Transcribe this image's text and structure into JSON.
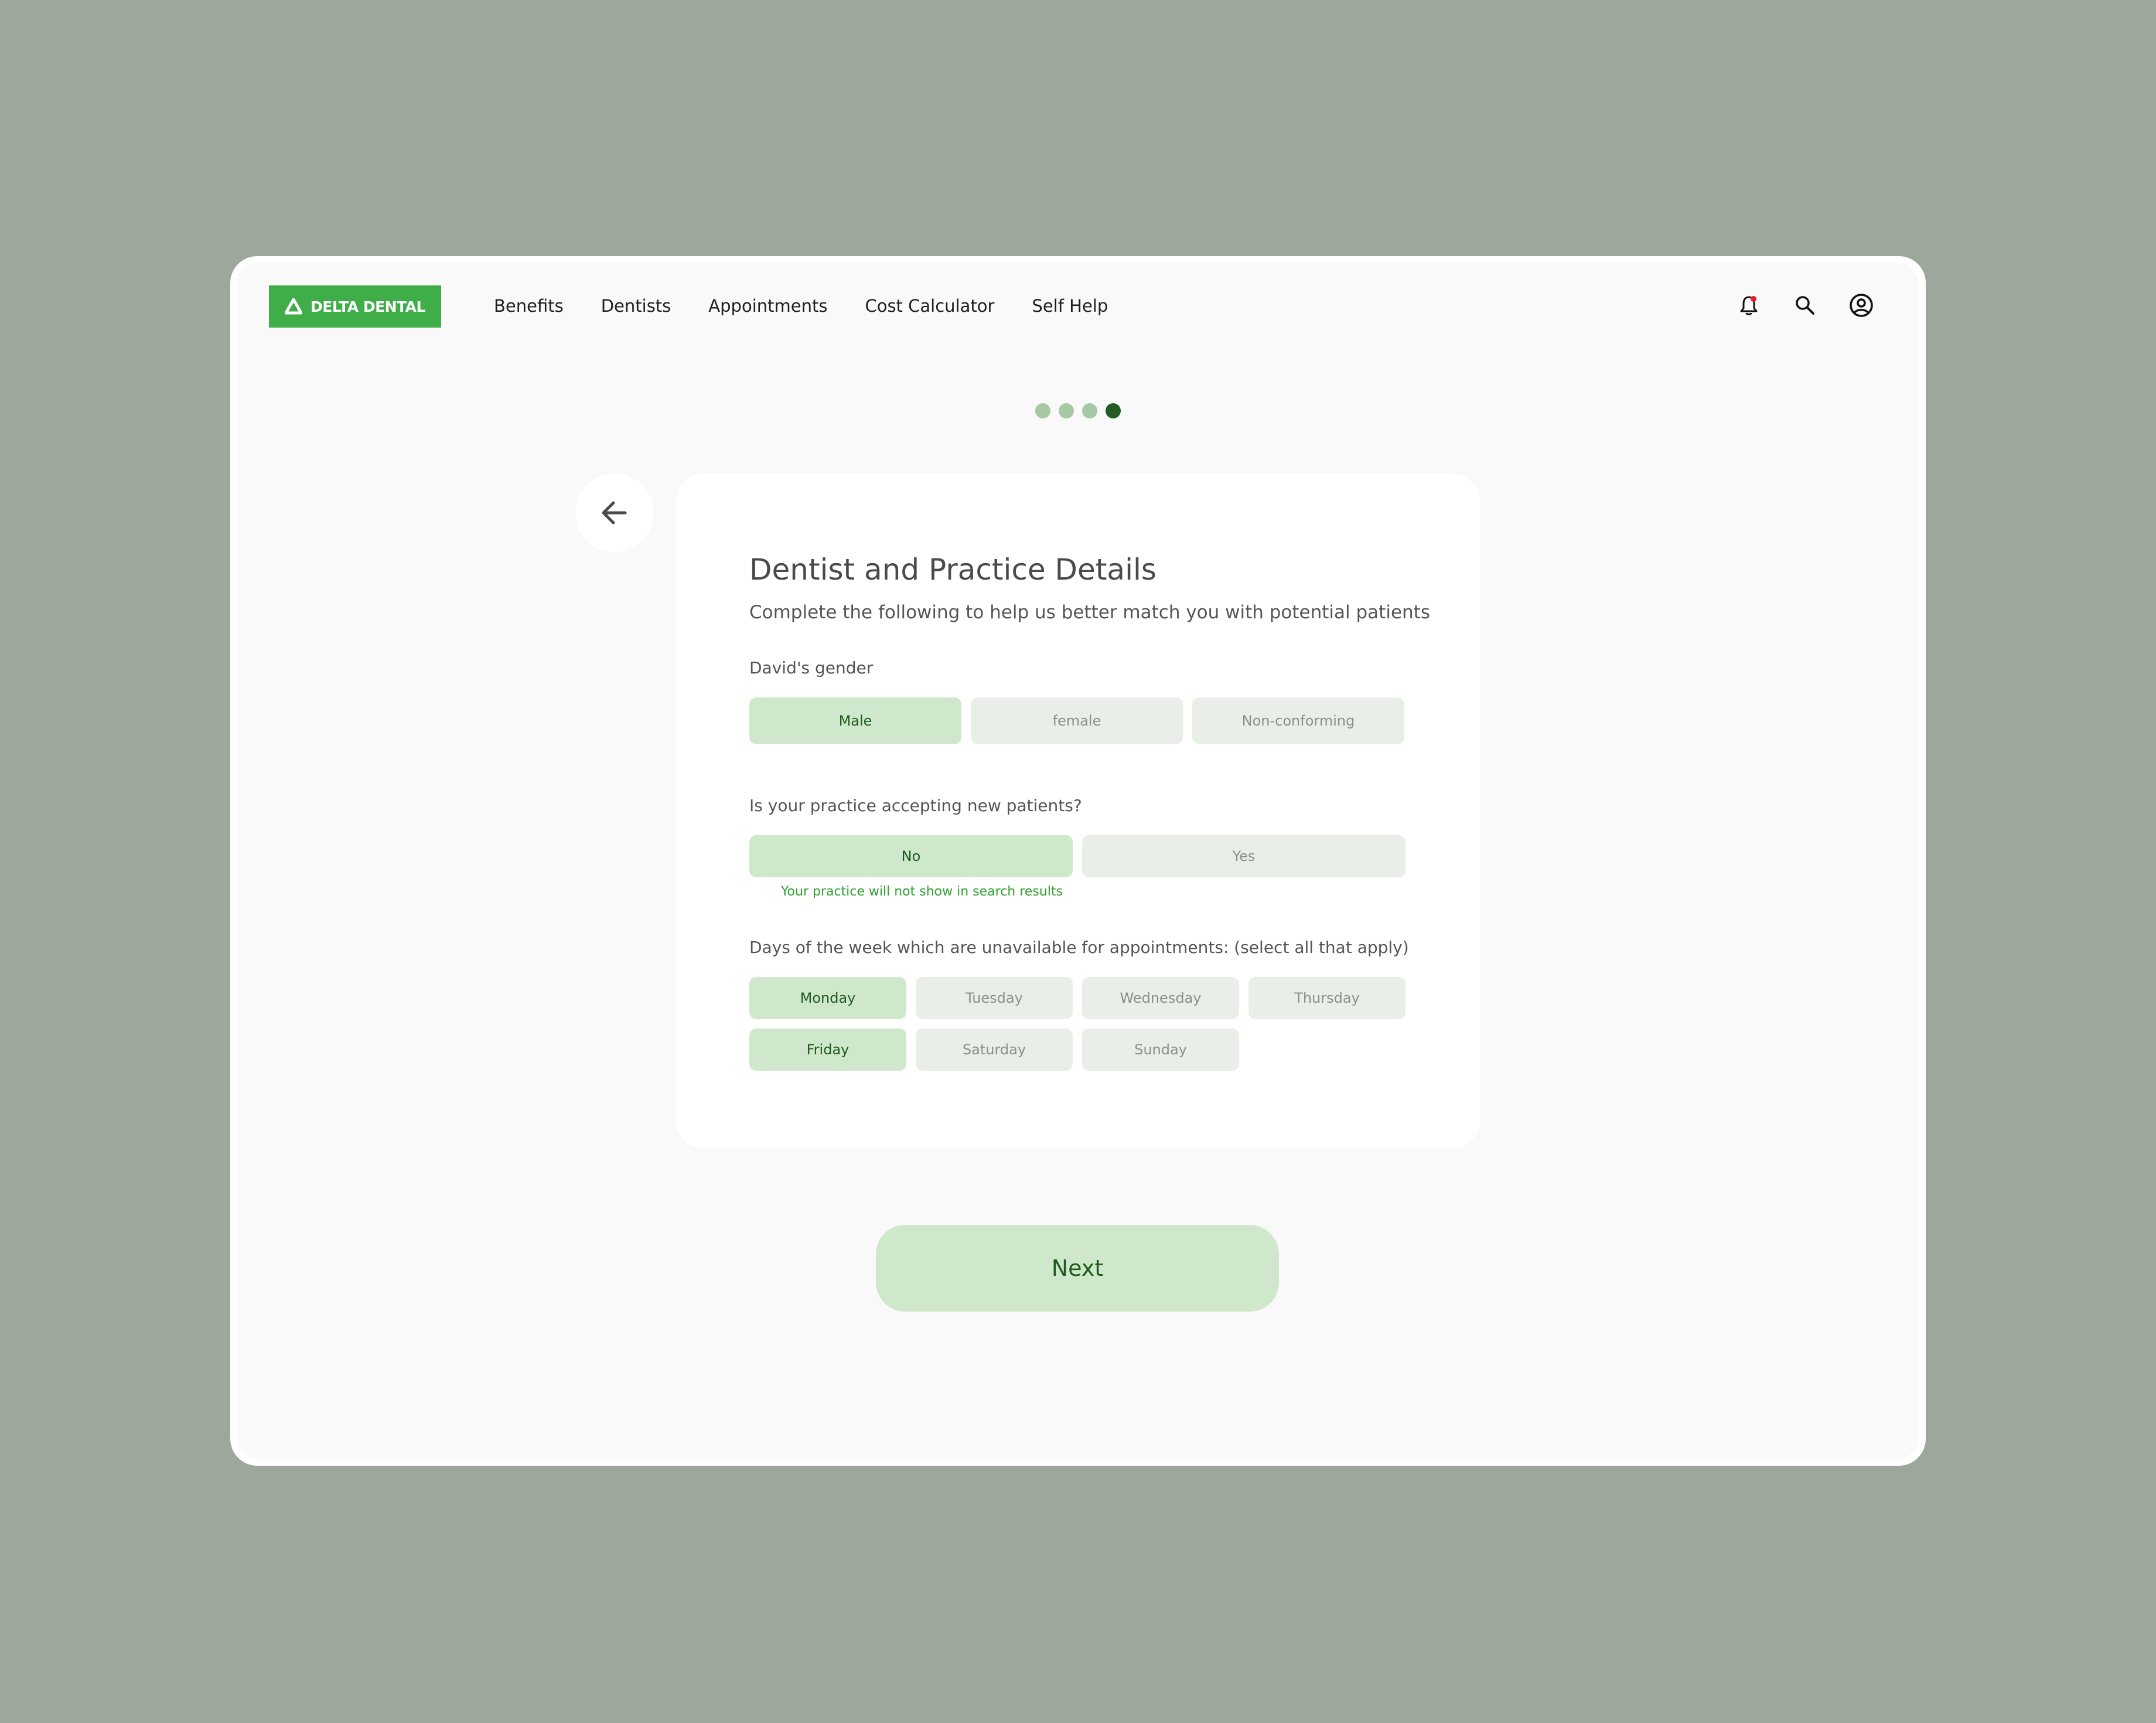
{
  "brand": {
    "name": "DELTA DENTAL",
    "color": "#3fae49"
  },
  "nav": {
    "items": [
      {
        "label": "Benefits"
      },
      {
        "label": "Dentists"
      },
      {
        "label": "Appointments"
      },
      {
        "label": "Cost Calculator"
      },
      {
        "label": "Self Help"
      }
    ]
  },
  "header_icons": [
    "bell-icon",
    "search-icon",
    "account-icon"
  ],
  "progress": {
    "total_steps": 4,
    "current_step": 4
  },
  "form": {
    "title": "Dentist and Practice Details",
    "subtitle": "Complete the following to help us better match you with potential patients",
    "gender": {
      "label": "David's gender",
      "options": [
        "Male",
        "female",
        "Non-conforming"
      ],
      "selected": "Male"
    },
    "accepting": {
      "label": "Is your practice accepting new patients?",
      "options": [
        "No",
        "Yes"
      ],
      "selected": "No",
      "hint": "Your  practice will not show in search results"
    },
    "days": {
      "label": "Days of the week which are unavailable for appointments: (select all that apply)",
      "options": [
        "Monday",
        "Tuesday",
        "Wednesday",
        "Thursday",
        "Friday",
        "Saturday",
        "Sunday"
      ],
      "selected": [
        "Monday",
        "Friday"
      ]
    }
  },
  "next_button": {
    "label": "Next"
  },
  "colors": {
    "background": "#9ea79c",
    "selected_bg": "#cfe8cb",
    "selected_text": "#1e5a1e",
    "unselected_bg": "#e9eee8",
    "hint": "#2ea12e",
    "dot_active": "#235b23",
    "dot_inactive": "#a6c9a3",
    "notification_dot": "#e0202a"
  }
}
